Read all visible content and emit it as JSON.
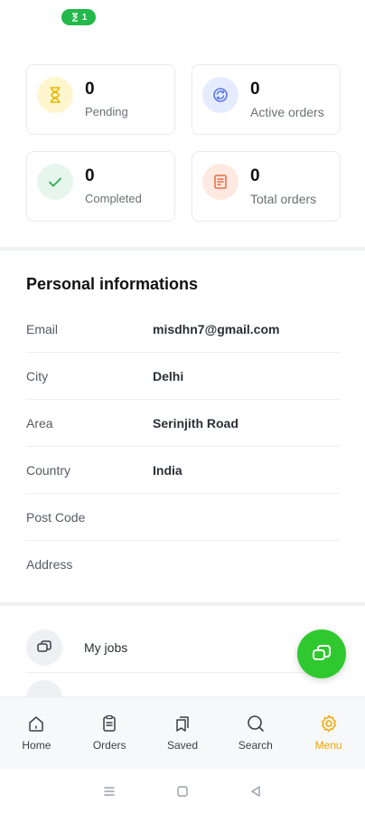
{
  "status": {
    "badge_count": "1"
  },
  "stats": [
    {
      "value": "0",
      "label": "Pending",
      "icon": "hourglass-icon",
      "bg": "#fff6cf",
      "color": "#e9b500"
    },
    {
      "value": "0",
      "label": "Active orders",
      "icon": "refresh-icon",
      "bg": "#e6ecff",
      "color": "#5a78e6"
    },
    {
      "value": "0",
      "label": "Completed",
      "icon": "check-icon",
      "bg": "#e7f6ec",
      "color": "#2fa84f"
    },
    {
      "value": "0",
      "label": "Total orders",
      "icon": "receipt-icon",
      "bg": "#ffe9e0",
      "color": "#e86a45"
    }
  ],
  "personal": {
    "title": "Personal informations",
    "rows": [
      {
        "key": "Email",
        "value": "misdhn7@gmail.com"
      },
      {
        "key": "City",
        "value": "Delhi"
      },
      {
        "key": "Area",
        "value": "Serinjith Road"
      },
      {
        "key": "Country",
        "value": "India"
      },
      {
        "key": "Post Code",
        "value": ""
      },
      {
        "key": "Address",
        "value": ""
      }
    ]
  },
  "menu": {
    "items": [
      {
        "label": "My jobs",
        "icon": "chat-bubbles-icon"
      }
    ]
  },
  "nav": {
    "items": [
      {
        "label": "Home",
        "icon": "home-icon"
      },
      {
        "label": "Orders",
        "icon": "clipboard-icon"
      },
      {
        "label": "Saved",
        "icon": "bookmark-stack-icon"
      },
      {
        "label": "Search",
        "icon": "search-icon"
      },
      {
        "label": "Menu",
        "icon": "gear-icon"
      }
    ],
    "active_color": "#f0a500"
  },
  "accent_green": "#2fc92f"
}
